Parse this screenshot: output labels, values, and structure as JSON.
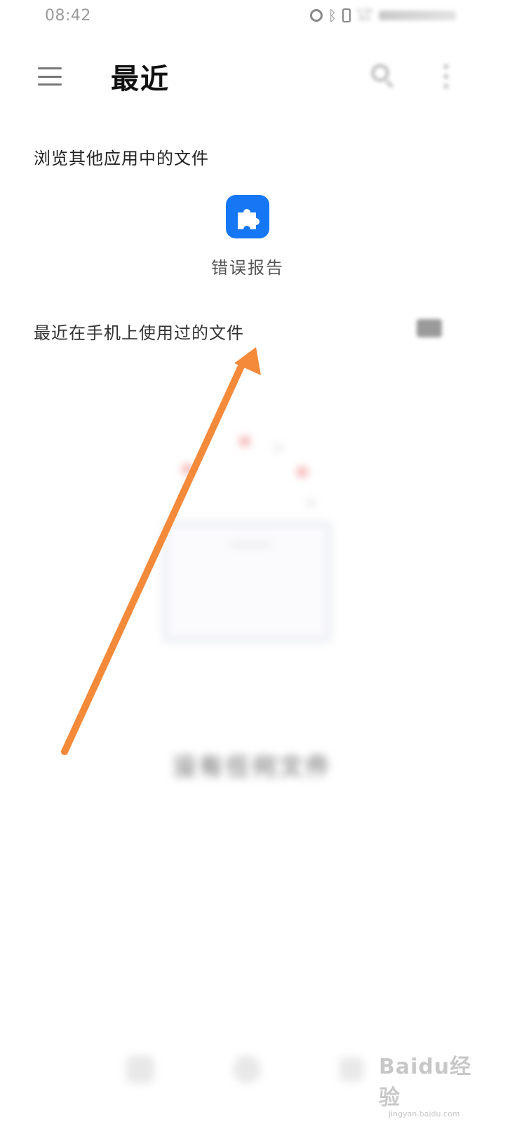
{
  "status_bar": {
    "time": "08:42",
    "icons": [
      "alarm-icon",
      "bluetooth-icon",
      "vibrate-icon",
      "network-speed-icon",
      "signal-icon"
    ],
    "speed_top": "0.00",
    "speed_unit": "B/S"
  },
  "app_bar": {
    "title": "最近",
    "icons": [
      "menu-icon",
      "search-icon",
      "more-icon"
    ]
  },
  "browse_section": {
    "label": "浏览其他应用中的文件",
    "apps": [
      {
        "label": "错误报告",
        "icon": "puzzle-piece-icon",
        "color": "#1677f5"
      }
    ]
  },
  "recent_section": {
    "label": "最近在手机上使用过的文件",
    "toggle_icon": "view-toggle-icon"
  },
  "empty_state": {
    "text": "没有任何文件"
  },
  "overlay": {
    "arrow_color": "#f58a3a"
  },
  "watermark": {
    "logo": "Baidu经验",
    "sub": "jingyan.baidu.com"
  }
}
